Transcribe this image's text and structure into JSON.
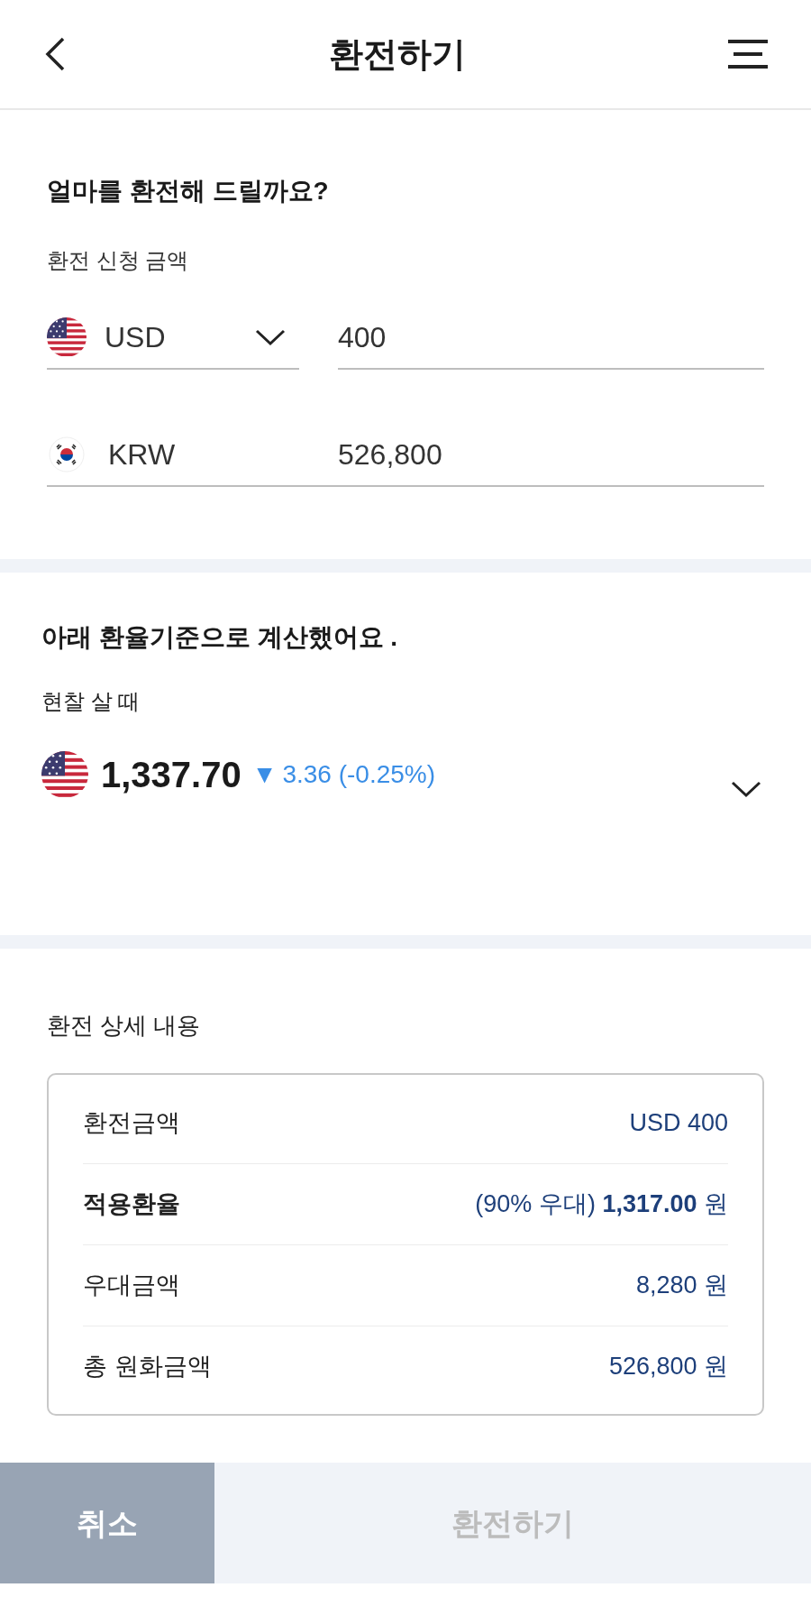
{
  "header": {
    "title": "환전하기"
  },
  "amount_section": {
    "heading": "얼마를 환전해 드릴까요?",
    "label": "환전 신청 금액",
    "from": {
      "currency": "USD",
      "value": "400"
    },
    "to": {
      "currency": "KRW",
      "value": "526,800"
    }
  },
  "rate_section": {
    "heading": "아래 환율기준으로 계산했어요 .",
    "label": "현찰 살 때",
    "rate": "1,337.70",
    "change_arrow": "▼",
    "change": "3.36 (-0.25%)",
    "expanded": false
  },
  "details": {
    "title": "환전 상세 내용",
    "rows": [
      {
        "label": "환전금액",
        "value": "USD 400",
        "emphasis": false
      },
      {
        "label": "적용환율",
        "value": "(90% 우대) **1,317.00** 원",
        "emphasis": true
      },
      {
        "label": "우대금액",
        "value": "8,280 원",
        "emphasis": false
      },
      {
        "label": "총 원화금액",
        "value": "526,800 원",
        "emphasis": false
      }
    ]
  },
  "buttons": [
    {
      "label": "취소",
      "kind": "secondary",
      "disabled": false
    },
    {
      "label": "환전하기",
      "kind": "primary",
      "disabled": true
    }
  ]
}
